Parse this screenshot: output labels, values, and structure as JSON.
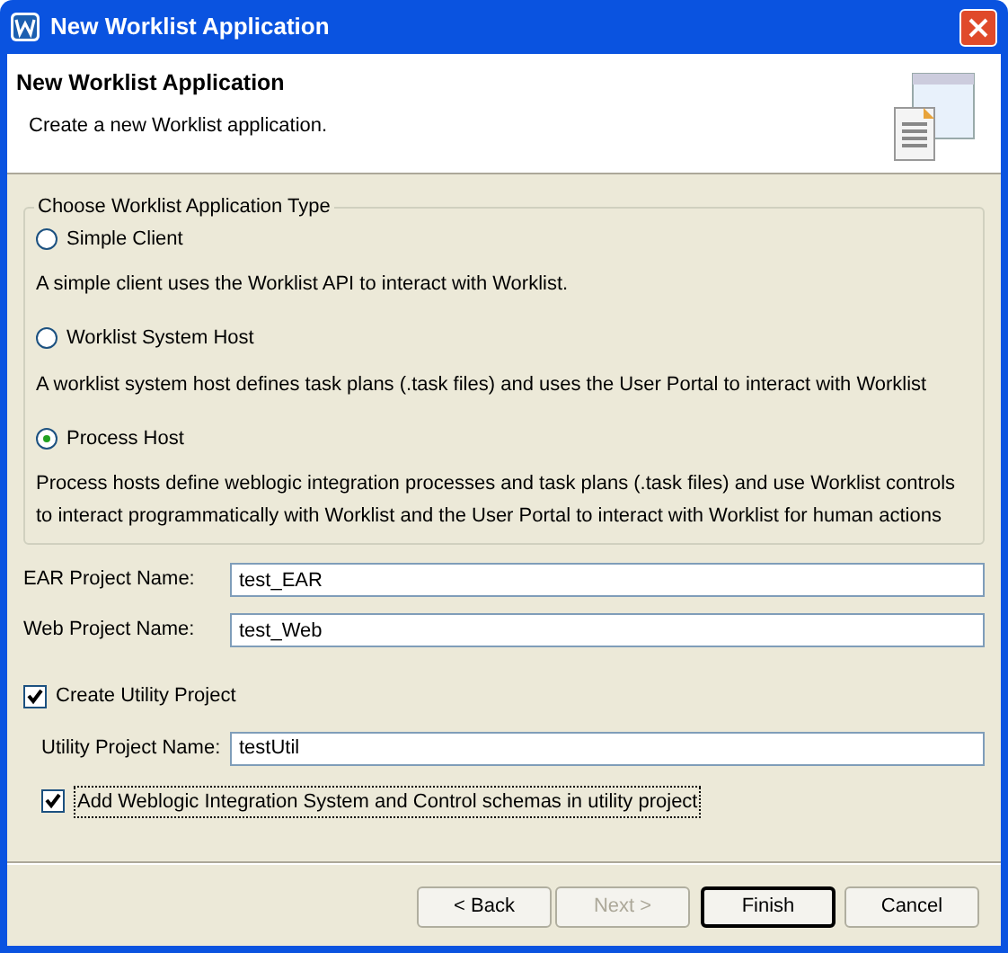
{
  "window": {
    "title": "New Worklist Application"
  },
  "header": {
    "title": "New Worklist Application",
    "description": "Create a new Worklist application."
  },
  "application_type": {
    "legend": "Choose Worklist Application Type",
    "options": [
      {
        "label": "Simple Client",
        "description": "A simple client uses the Worklist API to interact with Worklist.",
        "selected": false
      },
      {
        "label": "Worklist System Host",
        "description": "A worklist system host defines task plans (.task files) and uses the User Portal to interact with Worklist",
        "selected": false
      },
      {
        "label": "Process Host",
        "description": "Process hosts define weblogic integration processes and task plans (.task files) and use Worklist controls to interact programmatically with Worklist and the User Portal to interact with Worklist for human actions",
        "selected": true
      }
    ]
  },
  "fields": [
    {
      "label": "EAR Project Name:",
      "value": "test_EAR"
    },
    {
      "label": "Web Project Name:",
      "value": "test_Web"
    }
  ],
  "create_utility": {
    "label": "Create Utility Project",
    "checked": true
  },
  "utility_field": {
    "label": "Utility Project Name:",
    "value": "testUtil"
  },
  "schemas_checkbox": {
    "label": "Add Weblogic Integration System and Control schemas in utility project",
    "checked": true
  },
  "buttons": [
    {
      "label": "< Back",
      "disabled": false,
      "default": false
    },
    {
      "label": "Next >",
      "disabled": true,
      "default": false
    },
    {
      "label": "Finish",
      "disabled": false,
      "default": true
    },
    {
      "label": "Cancel",
      "disabled": false,
      "default": false
    }
  ]
}
